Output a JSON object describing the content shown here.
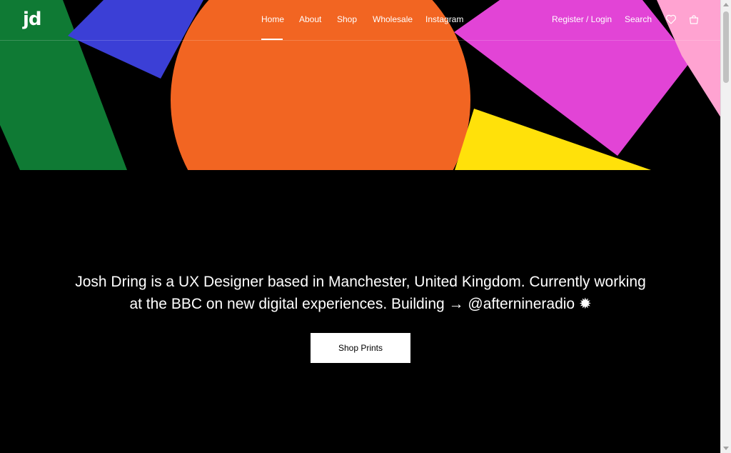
{
  "brand": {
    "logo": "jd"
  },
  "nav": {
    "items": [
      {
        "label": "Home"
      },
      {
        "label": "About"
      },
      {
        "label": "Shop"
      },
      {
        "label": "Wholesale"
      },
      {
        "label": "Instagram"
      }
    ]
  },
  "header_right": {
    "account": "Register / Login",
    "search": "Search"
  },
  "icons": [
    "heart-icon",
    "shopping-bag-icon"
  ],
  "colors": {
    "background": "#000000",
    "green": "#0f7a34",
    "blue": "#3b3fd6",
    "orange": "#f26522",
    "magenta": "#e244d6",
    "yellow": "#ffe10a",
    "pink": "#ffa3d1"
  },
  "intro": {
    "text": "Josh Dring is a UX Designer based in Manchester, United Kingdom. Currently working at the BBC on new digital experiences. Building → @afternineradio ✹"
  },
  "cta": {
    "label": "Shop Prints"
  }
}
